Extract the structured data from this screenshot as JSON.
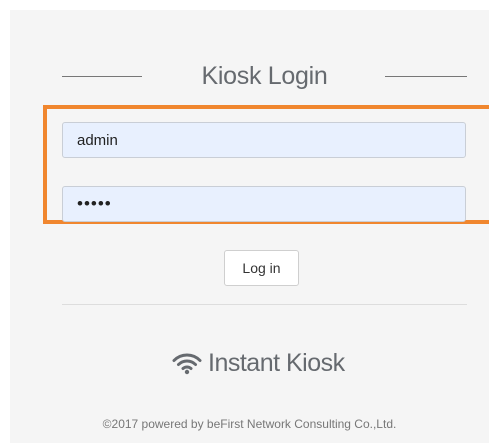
{
  "login": {
    "title": "Kiosk Login",
    "username_value": "admin",
    "password_value": "•••••",
    "submit_label": "Log in"
  },
  "brand": {
    "icon": "wifi-icon",
    "name": "Instant Kiosk"
  },
  "footer": {
    "copyright": "©2017 powered by beFirst Network Consulting Co.,Ltd."
  },
  "colors": {
    "highlight": "#f0862e",
    "input_background": "#e8f0fe",
    "panel_background": "#f5f5f5"
  }
}
